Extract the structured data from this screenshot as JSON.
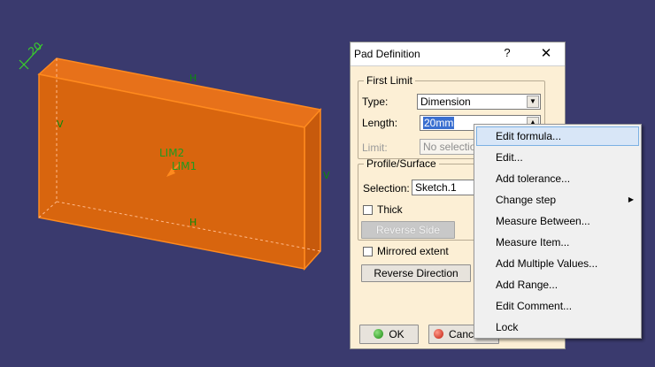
{
  "viewport": {
    "dimension_label": "20",
    "marker_h": "H",
    "marker_v": "V",
    "lim_labels": [
      "LIM2",
      "LIM1"
    ],
    "colors": {
      "background": "#3a3a6e",
      "pad_fill": "#d8650e",
      "pad_edge": "#ff8a1e"
    }
  },
  "dialog": {
    "title": "Pad Definition",
    "help_label": "?",
    "close_label": "✕",
    "first_limit": {
      "legend": "First Limit",
      "type_label": "Type:",
      "type_value": "Dimension",
      "length_label": "Length:",
      "length_value": "20mm",
      "limit_label": "Limit:",
      "limit_value": "No selection"
    },
    "profile_surface": {
      "legend": "Profile/Surface",
      "selection_label": "Selection:",
      "selection_value": "Sketch.1",
      "thick_label": "Thick",
      "thick_checked": false,
      "reverse_side_label": "Reverse Side"
    },
    "mirrored_extent_label": "Mirrored extent",
    "mirrored_extent_checked": false,
    "reverse_direction_label": "Reverse Direction",
    "ok_label": "OK",
    "cancel_label": "Cancel"
  },
  "context_menu": {
    "items": [
      {
        "label": "Edit formula...",
        "highlighted": true,
        "submenu": false
      },
      {
        "label": "Edit...",
        "highlighted": false,
        "submenu": false
      },
      {
        "label": "Add tolerance...",
        "highlighted": false,
        "submenu": false
      },
      {
        "label": "Change step",
        "highlighted": false,
        "submenu": true
      },
      {
        "label": "Measure Between...",
        "highlighted": false,
        "submenu": false
      },
      {
        "label": "Measure Item...",
        "highlighted": false,
        "submenu": false
      },
      {
        "label": "Add Multiple Values...",
        "highlighted": false,
        "submenu": false
      },
      {
        "label": "Add Range...",
        "highlighted": false,
        "submenu": false
      },
      {
        "label": "Edit Comment...",
        "highlighted": false,
        "submenu": false
      },
      {
        "label": "Lock",
        "highlighted": false,
        "submenu": false
      }
    ]
  }
}
